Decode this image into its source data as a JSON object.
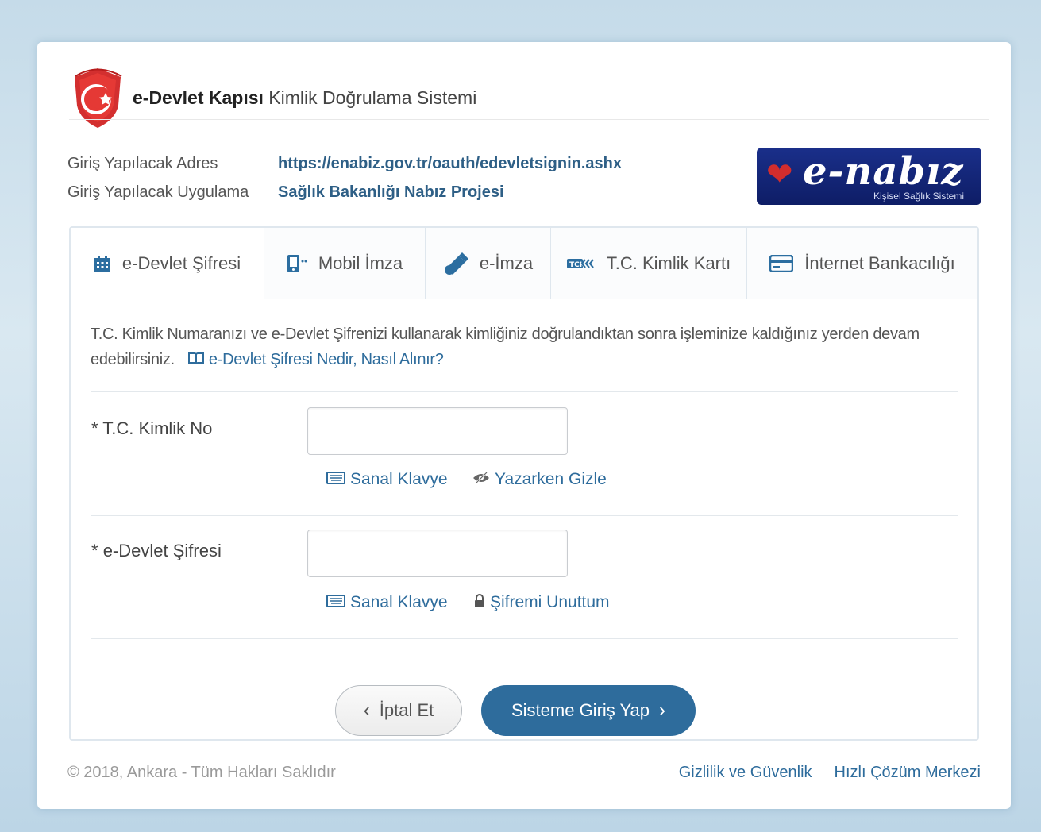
{
  "brand": {
    "title_bold": "e-Devlet Kapısı",
    "title_rest": "Kimlik Doğrulama Sistemi"
  },
  "meta": {
    "address_label": "Giriş Yapılacak Adres",
    "address_value": "https://enabiz.gov.tr/oauth/edevletsignin.ashx",
    "app_label": "Giriş Yapılacak Uygulama",
    "app_value": "Sağlık Bakanlığı Nabız Projesi"
  },
  "app_logo": {
    "name": "e-nabız",
    "subtitle": "Kişisel Sağlık Sistemi"
  },
  "tabs": [
    {
      "label": "e-Devlet Şifresi",
      "icon": "calendar-grid-icon",
      "active": true
    },
    {
      "label": "Mobil İmza",
      "icon": "mobile-signature-icon",
      "active": false
    },
    {
      "label": "e-İmza",
      "icon": "usb-token-icon",
      "active": false
    },
    {
      "label": "T.C. Kimlik Kartı",
      "icon": "id-card-icon",
      "active": false
    },
    {
      "label": "İnternet Bankacılığı",
      "icon": "credit-card-icon",
      "active": false
    }
  ],
  "intro": {
    "text": "T.C. Kimlik Numaranızı ve e-Devlet Şifrenizi kullanarak kimliğiniz doğrulandıktan sonra işleminize kaldığınız yerden devam edebilirsiniz.",
    "link": "e-Devlet Şifresi Nedir, Nasıl Alınır?"
  },
  "form": {
    "tc_label": "T.C. Kimlik No",
    "tc_value": "",
    "password_label": "e-Devlet Şifresi",
    "password_value": "",
    "required_mark": "*",
    "virtual_keyboard": "Sanal Klavye",
    "hide_while_typing": "Yazarken Gizle",
    "forgot_password": "Şifremi Unuttum"
  },
  "buttons": {
    "cancel": "İptal Et",
    "submit": "Sisteme Giriş Yap"
  },
  "footer": {
    "copyright": "© 2018, Ankara - Tüm Hakları Saklıdır",
    "privacy": "Gizlilik ve Güvenlik",
    "help": "Hızlı Çözüm Merkezi"
  },
  "colors": {
    "accent": "#2e6c9c",
    "brand_red": "#d32f2f",
    "logo_navy": "#13247a"
  }
}
